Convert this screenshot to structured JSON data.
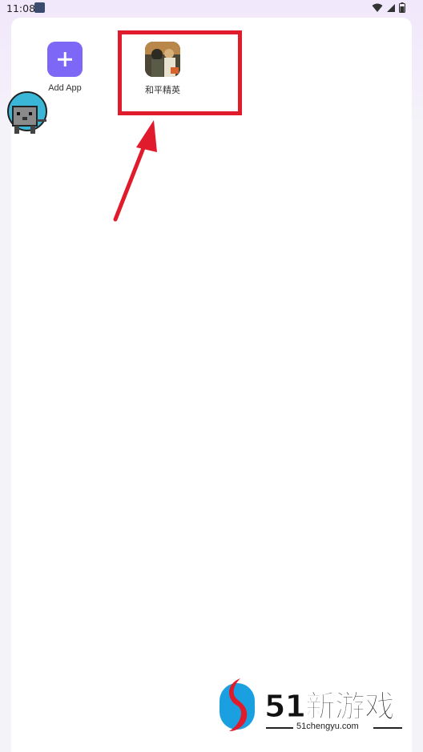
{
  "status_bar": {
    "time": "11:08"
  },
  "apps": [
    {
      "label": "Add App",
      "icon": "plus-icon"
    },
    {
      "label": "和平精英",
      "icon": "game-icon"
    }
  ],
  "watermark": {
    "brand": "51新游戏",
    "url": "51chengyu.com"
  },
  "colors": {
    "accent": "#7c67f6",
    "highlight": "#e01b2c"
  }
}
